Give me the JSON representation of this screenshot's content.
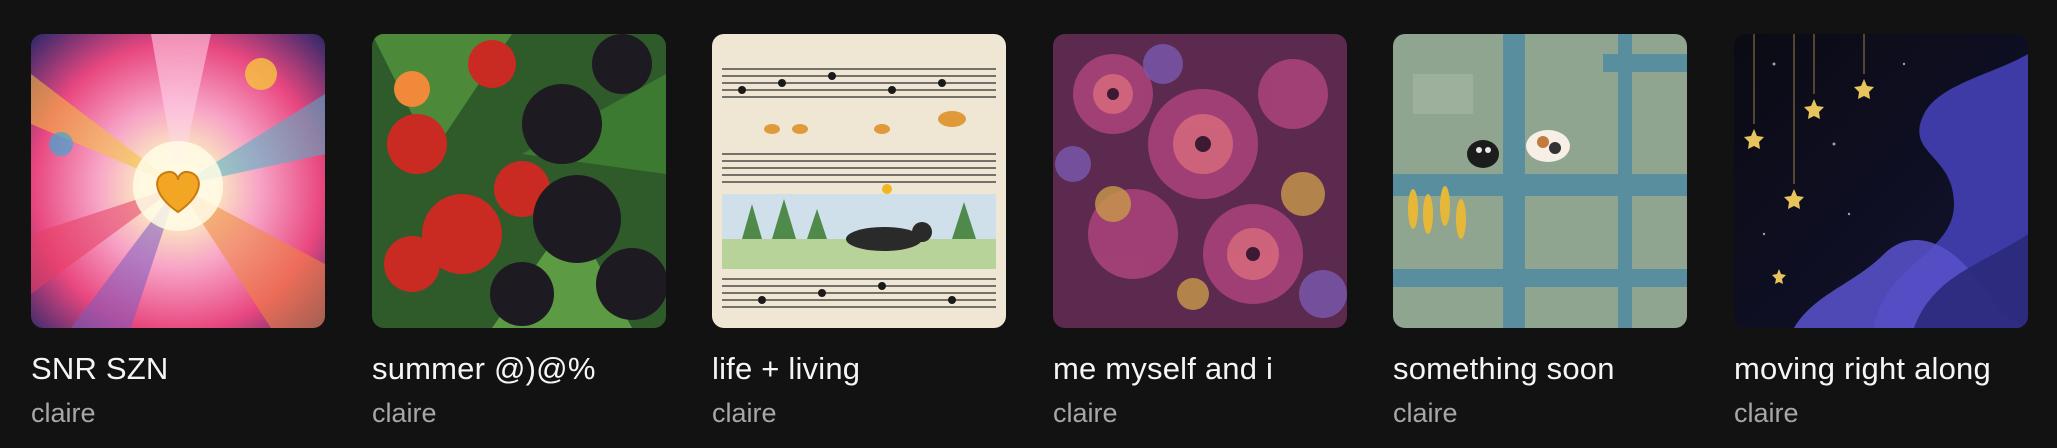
{
  "playlists": [
    {
      "title": "SNR SZN",
      "owner": "claire",
      "art": "radiant-heart-art"
    },
    {
      "title": "summer @)@%",
      "owner": "claire",
      "art": "berries-art"
    },
    {
      "title": "life + living",
      "owner": "claire",
      "art": "sheet-music-landscape-art"
    },
    {
      "title": "me myself and i",
      "owner": "claire",
      "art": "floral-pattern-art"
    },
    {
      "title": "something soon",
      "owner": "claire",
      "art": "cats-on-fence-art"
    },
    {
      "title": "moving right along",
      "owner": "claire",
      "art": "night-sky-art"
    }
  ],
  "colors": {
    "background": "#121212",
    "title": "#f5f5f5",
    "subtitle": "#a7a7a7"
  }
}
